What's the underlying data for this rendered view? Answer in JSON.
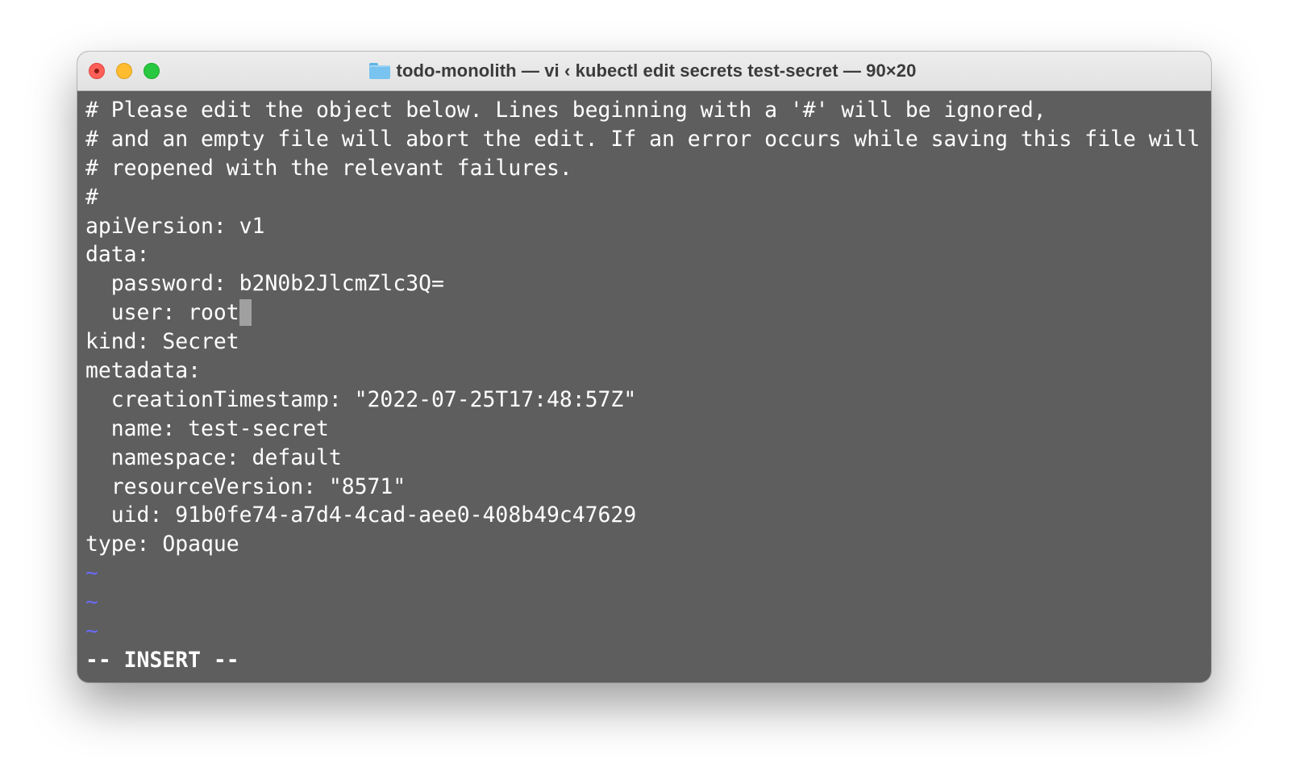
{
  "window": {
    "title": "todo-monolith — vi ‹ kubectl edit secrets test-secret — 90×20",
    "title_icon": "folder-icon",
    "traffic_lights": {
      "close": "#fe5f57",
      "minimize": "#febc2e",
      "maximize": "#28c840"
    }
  },
  "terminal": {
    "background": "#5e5e5e",
    "text_color": "#ffffff",
    "lines": [
      "# Please edit the object below. Lines beginning with a '#' will be ignored,",
      "# and an empty file will abort the edit. If an error occurs while saving this file will be",
      "# reopened with the relevant failures.",
      "#",
      "apiVersion: v1",
      "data:",
      "  password: b2N0b2JlcmZlc3Q=",
      "  user: root",
      "kind: Secret",
      "metadata:",
      "  creationTimestamp: \"2022-07-25T17:48:57Z\"",
      "  name: test-secret",
      "  namespace: default",
      "  resourceVersion: \"8571\"",
      "  uid: 91b0fe74-a7d4-4cad-aee0-408b49c47629",
      "type: Opaque"
    ],
    "empty_line_markers": [
      "~",
      "~",
      "~"
    ],
    "mode_indicator": "-- INSERT --"
  }
}
